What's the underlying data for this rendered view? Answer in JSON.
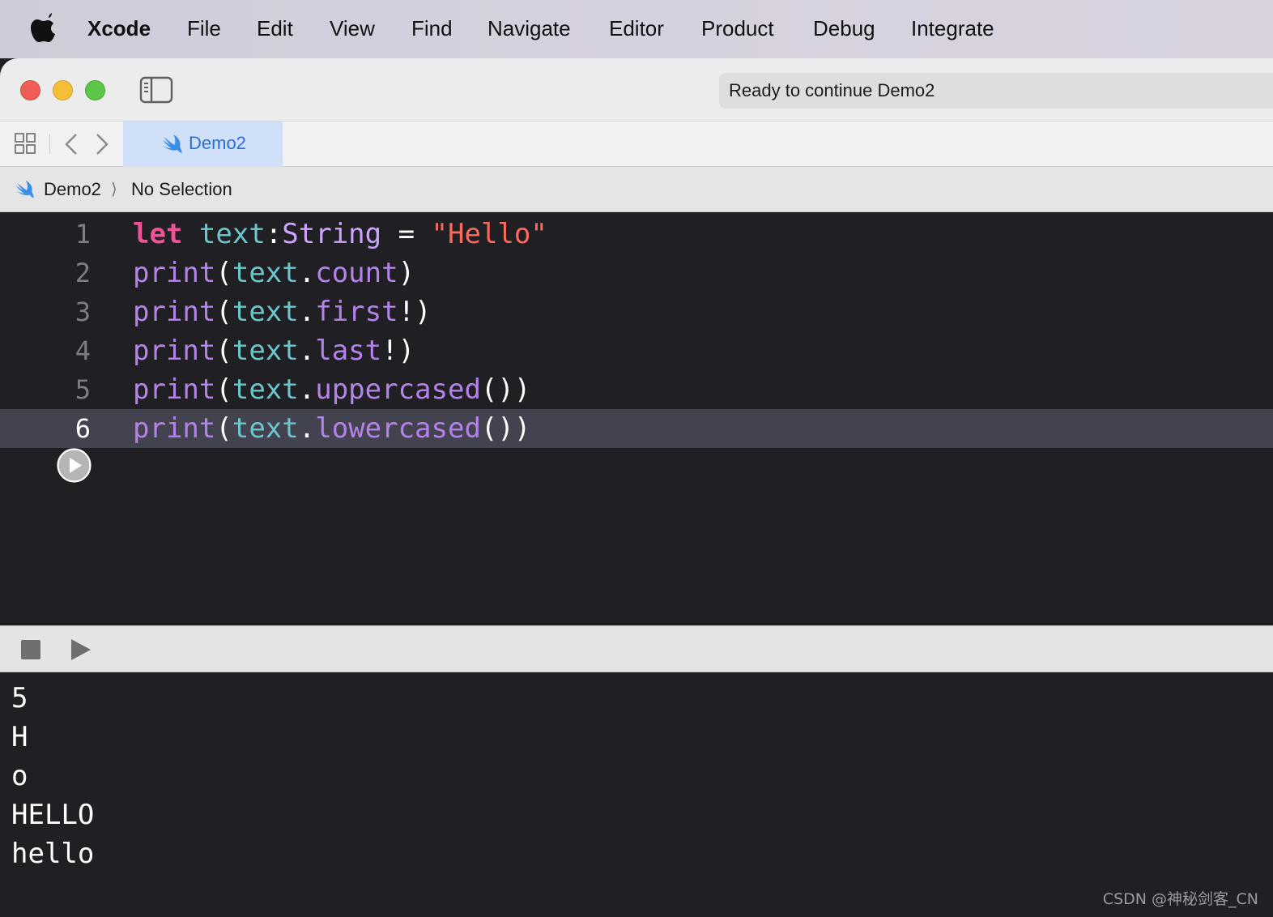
{
  "menubar": {
    "app_name": "Xcode",
    "items": [
      "File",
      "Edit",
      "View",
      "Find",
      "Navigate",
      "Editor",
      "Product",
      "Debug",
      "Integrate"
    ]
  },
  "toolbar": {
    "status_text": "Ready to continue Demo2"
  },
  "tabs": [
    {
      "label": "Demo2",
      "icon": "swift-icon",
      "active": true
    }
  ],
  "jumpbar": {
    "project": "Demo2",
    "separator": "⟩",
    "selection": "No Selection"
  },
  "editor": {
    "current_line": 6,
    "lines": [
      {
        "number": "1",
        "tokens": [
          {
            "t": "let",
            "c": "kw"
          },
          {
            "t": " ",
            "c": "plain"
          },
          {
            "t": "text",
            "c": "var"
          },
          {
            "t": ":",
            "c": "plain"
          },
          {
            "t": "String",
            "c": "type"
          },
          {
            "t": " = ",
            "c": "plain"
          },
          {
            "t": "\"Hello\"",
            "c": "str"
          }
        ]
      },
      {
        "number": "2",
        "tokens": [
          {
            "t": "print",
            "c": "fn"
          },
          {
            "t": "(",
            "c": "plain"
          },
          {
            "t": "text",
            "c": "var"
          },
          {
            "t": ".",
            "c": "plain"
          },
          {
            "t": "count",
            "c": "fn"
          },
          {
            "t": ")",
            "c": "plain"
          }
        ]
      },
      {
        "number": "3",
        "tokens": [
          {
            "t": "print",
            "c": "fn"
          },
          {
            "t": "(",
            "c": "plain"
          },
          {
            "t": "text",
            "c": "var"
          },
          {
            "t": ".",
            "c": "plain"
          },
          {
            "t": "first",
            "c": "fn"
          },
          {
            "t": "!)",
            "c": "plain"
          }
        ]
      },
      {
        "number": "4",
        "tokens": [
          {
            "t": "print",
            "c": "fn"
          },
          {
            "t": "(",
            "c": "plain"
          },
          {
            "t": "text",
            "c": "var"
          },
          {
            "t": ".",
            "c": "plain"
          },
          {
            "t": "last",
            "c": "fn"
          },
          {
            "t": "!)",
            "c": "plain"
          }
        ]
      },
      {
        "number": "5",
        "tokens": [
          {
            "t": "print",
            "c": "fn"
          },
          {
            "t": "(",
            "c": "plain"
          },
          {
            "t": "text",
            "c": "var"
          },
          {
            "t": ".",
            "c": "plain"
          },
          {
            "t": "uppercased",
            "c": "fn"
          },
          {
            "t": "())",
            "c": "plain"
          }
        ]
      },
      {
        "number": "6",
        "tokens": [
          {
            "t": "print",
            "c": "fn"
          },
          {
            "t": "(",
            "c": "plain"
          },
          {
            "t": "text",
            "c": "var"
          },
          {
            "t": ".",
            "c": "plain"
          },
          {
            "t": "lowercased",
            "c": "fn"
          },
          {
            "t": "())",
            "c": "plain"
          }
        ]
      }
    ]
  },
  "console": {
    "output": [
      "5",
      "H",
      "o",
      "HELLO",
      "hello"
    ]
  },
  "watermark": "CSDN @神秘剑客_CN",
  "colors": {
    "keyword": "#ee5396",
    "variable": "#6bc7cc",
    "type": "#cda3ff",
    "string": "#fc6a5d",
    "function": "#b482ea",
    "editor_bg": "#1f1f24",
    "current_line_bg": "#43424f",
    "tab_active_bg": "#cfe0f8",
    "tab_active_text": "#2a6ed8"
  }
}
